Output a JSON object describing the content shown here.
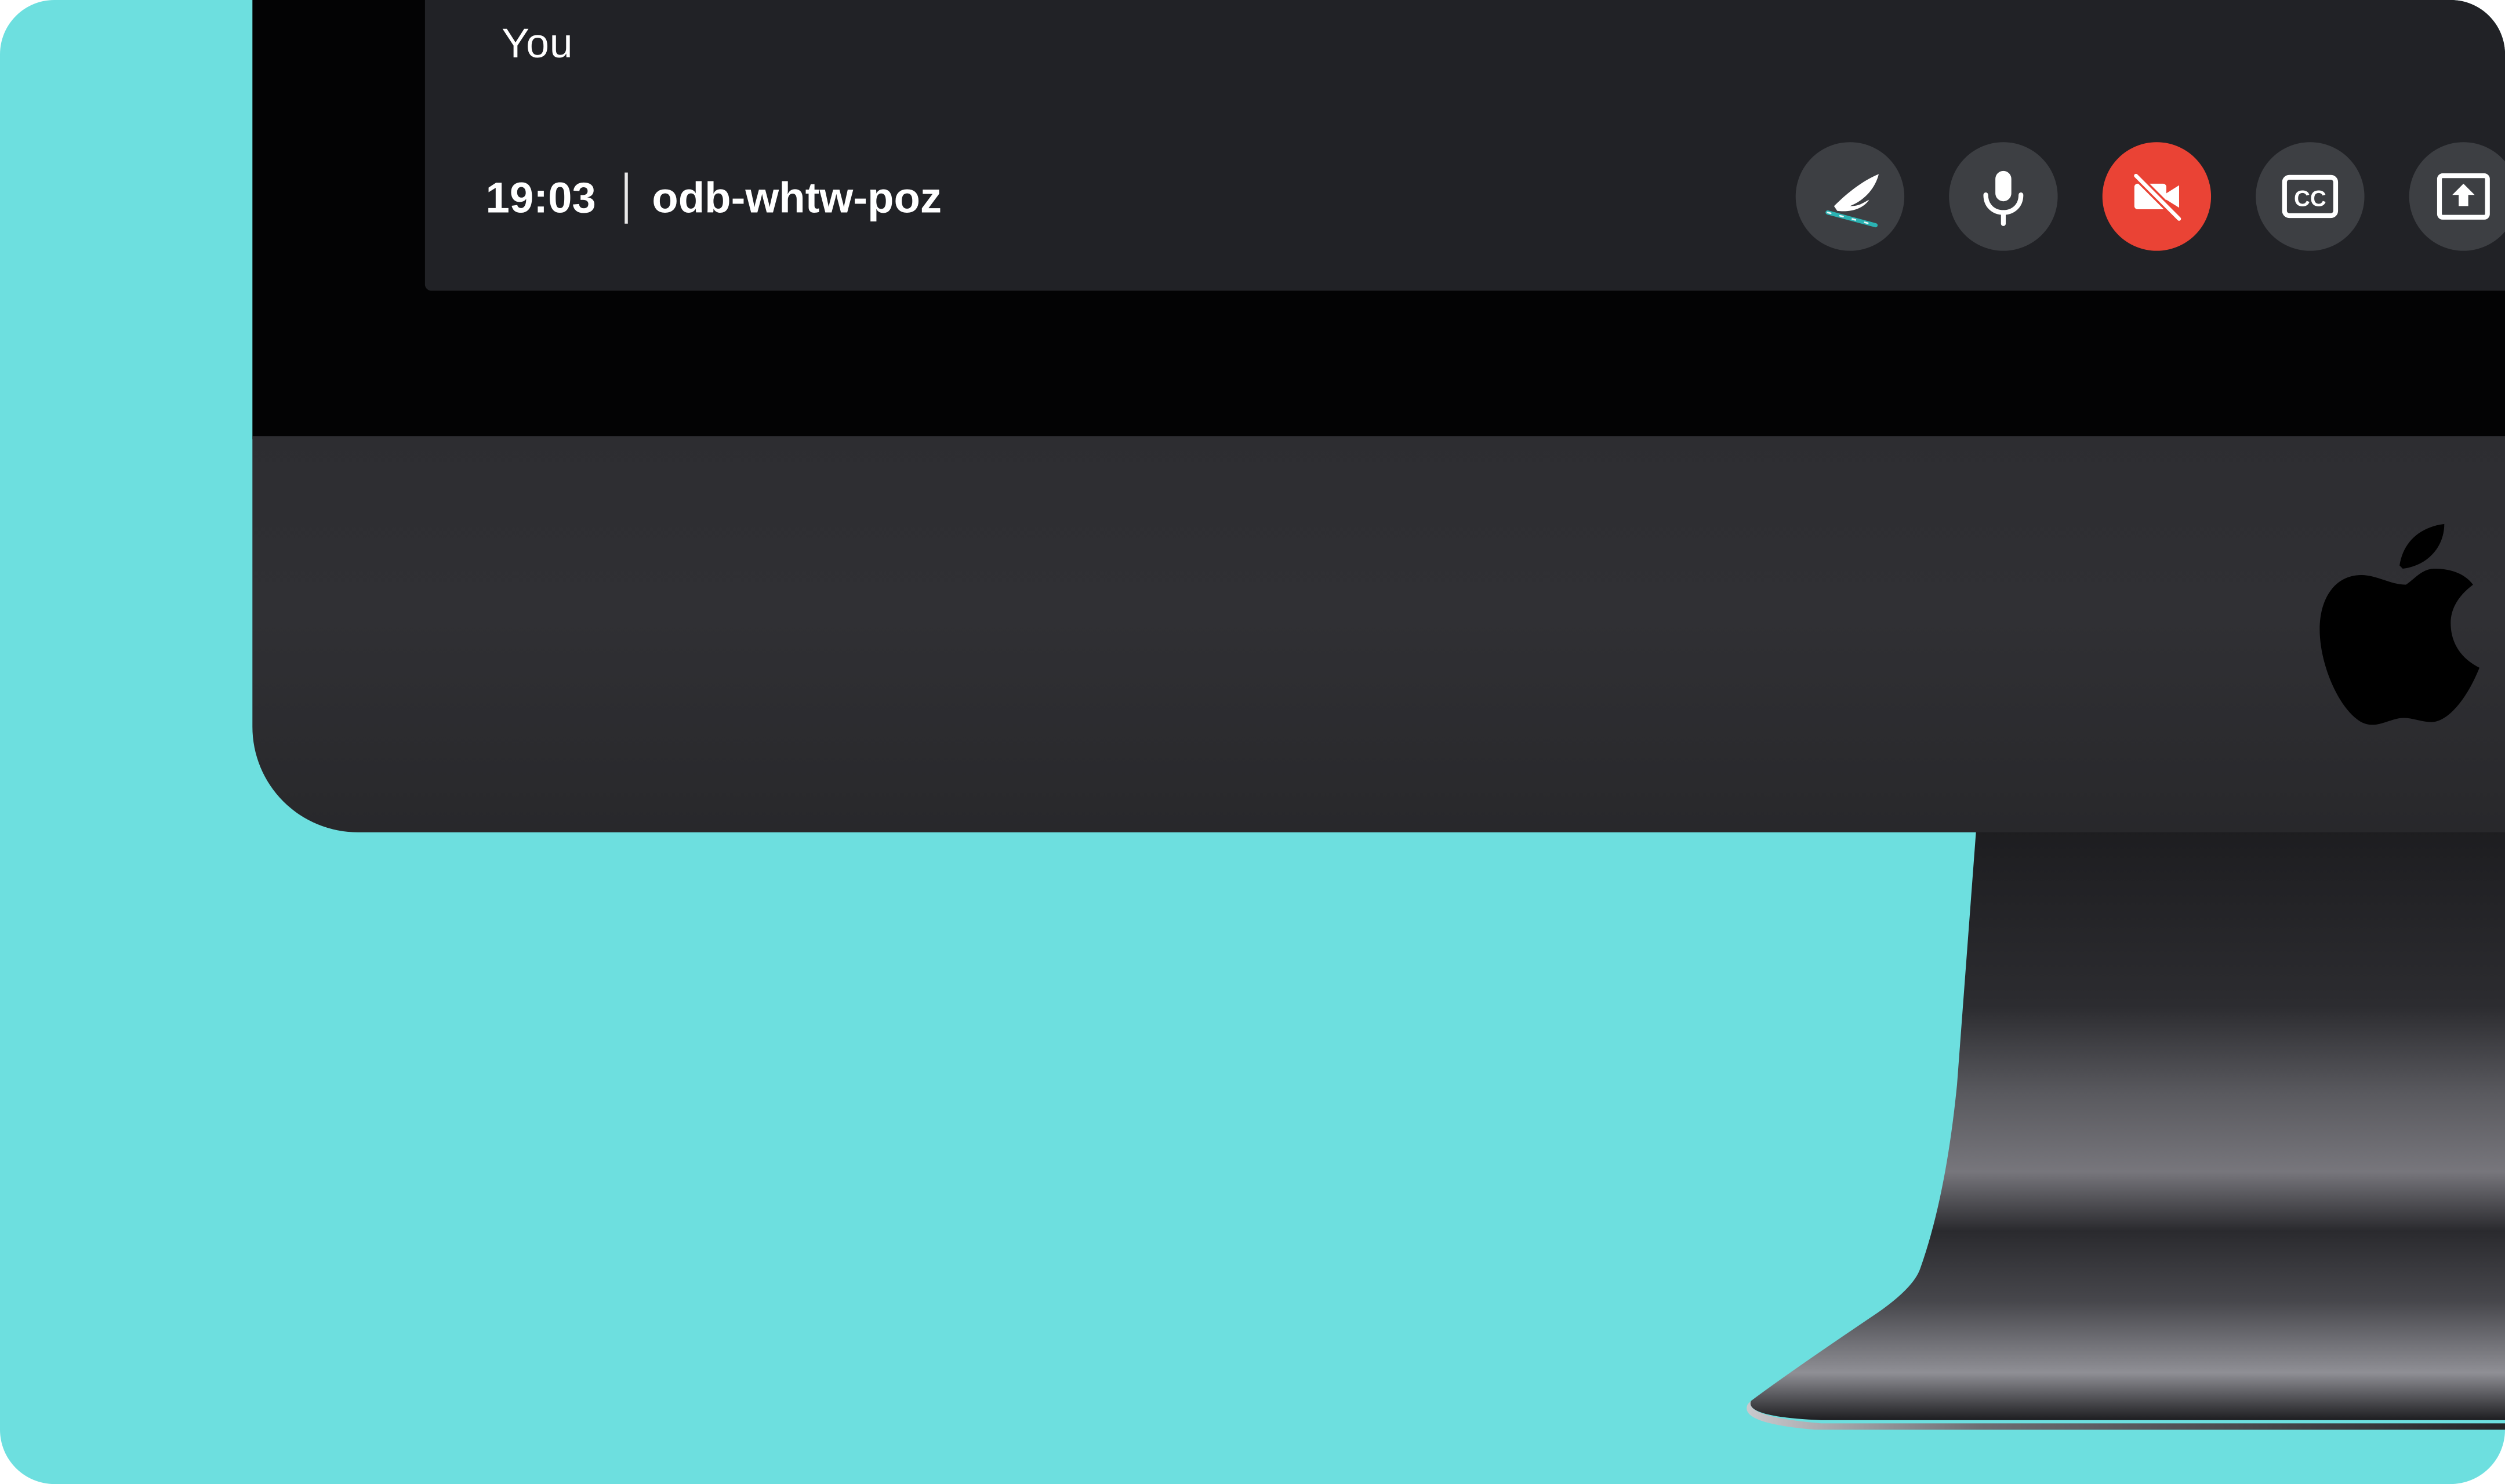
{
  "meeting": {
    "self_label": "You",
    "time": "19:03",
    "code": "odb-whtw-poz"
  },
  "controls": [
    {
      "name": "pen-drawing-button",
      "icon": "feather-pen-icon",
      "state": "neutral"
    },
    {
      "name": "microphone-button",
      "icon": "microphone-icon",
      "state": "on"
    },
    {
      "name": "camera-button",
      "icon": "camera-off-icon",
      "state": "off"
    },
    {
      "name": "captions-button",
      "icon": "closed-captions-icon",
      "state": "off"
    },
    {
      "name": "present-screen-button",
      "icon": "present-icon",
      "state": "off"
    }
  ],
  "colors": {
    "background": "#6ddfdf",
    "meet_bar": "#212226",
    "control_button": "#3d3f43",
    "camera_off_red": "#ea4335",
    "device_body": "#2d2d31"
  },
  "device": {
    "type": "imac-mockup",
    "brand_icon": "apple-logo-icon"
  }
}
